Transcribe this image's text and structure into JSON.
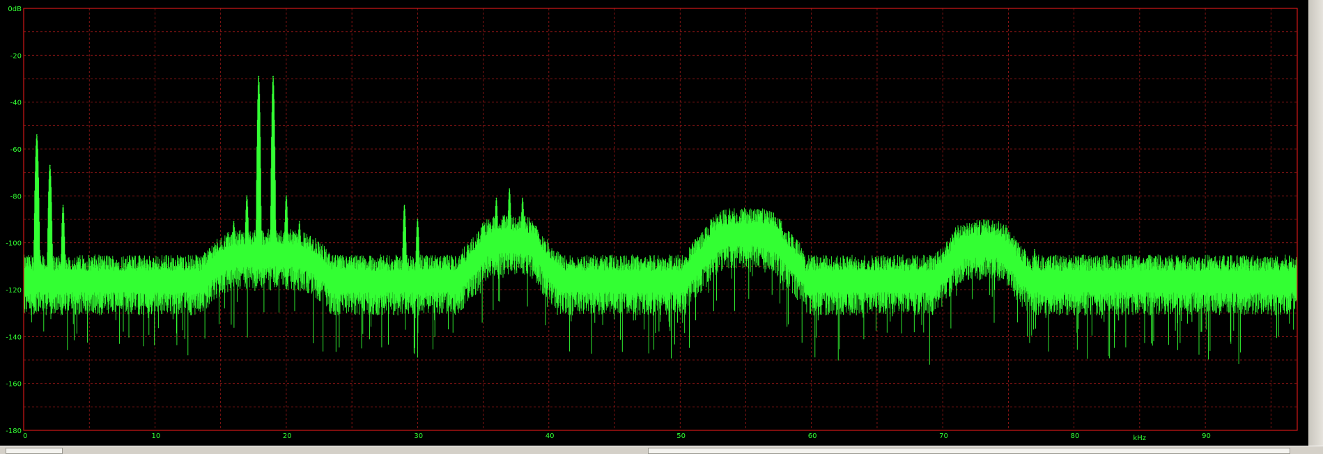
{
  "chart_data": {
    "type": "line",
    "xlabel": "kHz",
    "ylabel": "",
    "title": "",
    "xlim": [
      0,
      97
    ],
    "ylim": [
      -180,
      0
    ],
    "x_ticks": [
      0,
      10,
      20,
      30,
      40,
      50,
      60,
      70,
      80,
      90
    ],
    "x_tick_labels": [
      "0",
      "10",
      "20",
      "30",
      "40",
      "50",
      "60",
      "70",
      "80",
      "90"
    ],
    "y_ticks": [
      0,
      -20,
      -40,
      -60,
      -80,
      -100,
      -120,
      -140,
      -160,
      -180
    ],
    "y_tick_labels": [
      "0dB",
      "-20",
      "-40",
      "-60",
      "-80",
      "-100",
      "-120",
      "-140",
      "-160",
      "-180"
    ],
    "grid": true,
    "colors": {
      "trace": "#33ff33",
      "grid": "#a01818",
      "frame": "#d01818",
      "background": "#000000"
    },
    "series": [
      {
        "noise_floor_db": -115,
        "peaks": [
          {
            "x": 1.0,
            "y": -54
          },
          {
            "x": 2.0,
            "y": -67
          },
          {
            "x": 3.0,
            "y": -84
          },
          {
            "x": 16.0,
            "y": -91
          },
          {
            "x": 17.0,
            "y": -80
          },
          {
            "x": 17.9,
            "y": -29
          },
          {
            "x": 19.0,
            "y": -29
          },
          {
            "x": 20.0,
            "y": -80
          },
          {
            "x": 21.0,
            "y": -91
          },
          {
            "x": 29.0,
            "y": -84
          },
          {
            "x": 30.0,
            "y": -90
          },
          {
            "x": 35.0,
            "y": -93
          },
          {
            "x": 36.0,
            "y": -81
          },
          {
            "x": 37.0,
            "y": -77
          },
          {
            "x": 38.0,
            "y": -81
          },
          {
            "x": 39.0,
            "y": -93
          },
          {
            "x": 53.0,
            "y": -92
          },
          {
            "x": 54.0,
            "y": -88
          },
          {
            "x": 55.0,
            "y": -86
          },
          {
            "x": 56.0,
            "y": -88
          },
          {
            "x": 57.0,
            "y": -92
          },
          {
            "x": 72.0,
            "y": -99
          },
          {
            "x": 73.0,
            "y": -98
          },
          {
            "x": 74.0,
            "y": -99
          },
          {
            "x": 77.0,
            "y": -103
          },
          {
            "x": 78.0,
            "y": -107
          }
        ],
        "bands": [
          {
            "from": 14.0,
            "to": 23.0,
            "level_db": -104
          },
          {
            "from": 34.5,
            "to": 39.5,
            "level_db": -98
          },
          {
            "from": 52.0,
            "to": 58.0,
            "level_db": -95
          },
          {
            "from": 70.5,
            "to": 75.5,
            "level_db": -100
          }
        ]
      }
    ]
  }
}
